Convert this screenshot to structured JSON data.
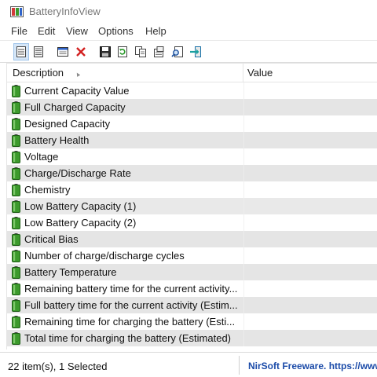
{
  "window": {
    "title": "BatteryInfoView"
  },
  "menu": {
    "items": [
      "File",
      "Edit",
      "View",
      "Options",
      "Help"
    ]
  },
  "toolbar": {
    "buttons": [
      {
        "icon": "view-summary-icon",
        "active": true
      },
      {
        "icon": "view-details-icon",
        "active": false
      },
      {
        "icon": "html-report-icon",
        "active": false
      },
      {
        "icon": "delete-icon",
        "active": false
      },
      {
        "icon": "save-icon",
        "active": false
      },
      {
        "icon": "refresh-icon",
        "active": false
      },
      {
        "icon": "copy-icon",
        "active": false
      },
      {
        "icon": "properties-icon",
        "active": false
      },
      {
        "icon": "find-icon",
        "active": false
      },
      {
        "icon": "exit-icon",
        "active": false
      }
    ]
  },
  "list": {
    "columns": {
      "description": "Description",
      "value": "Value"
    },
    "rows": [
      {
        "description": "Current Capacity Value",
        "value": ""
      },
      {
        "description": "Full Charged Capacity",
        "value": ""
      },
      {
        "description": "Designed Capacity",
        "value": ""
      },
      {
        "description": "Battery Health",
        "value": ""
      },
      {
        "description": "Voltage",
        "value": ""
      },
      {
        "description": "Charge/Discharge Rate",
        "value": ""
      },
      {
        "description": "Chemistry",
        "value": ""
      },
      {
        "description": "Low Battery Capacity (1)",
        "value": ""
      },
      {
        "description": "Low Battery Capacity (2)",
        "value": ""
      },
      {
        "description": "Critical Bias",
        "value": ""
      },
      {
        "description": "Number of charge/discharge cycles",
        "value": ""
      },
      {
        "description": "Battery Temperature",
        "value": ""
      },
      {
        "description": "Remaining battery time for the current activity...",
        "value": ""
      },
      {
        "description": "Full battery time for the current activity (Estim...",
        "value": ""
      },
      {
        "description": "Remaining time for charging the battery (Esti...",
        "value": ""
      },
      {
        "description": "Total  time for charging the battery (Estimated)",
        "value": ""
      }
    ]
  },
  "status": {
    "items_text": "22 item(s), 1 Selected",
    "link_text": "NirSoft Freeware. https://www"
  },
  "colors": {
    "row_alt": "#e5e5e5",
    "battery_green": "#3c9a2c",
    "link_blue": "#1a4aa8"
  }
}
